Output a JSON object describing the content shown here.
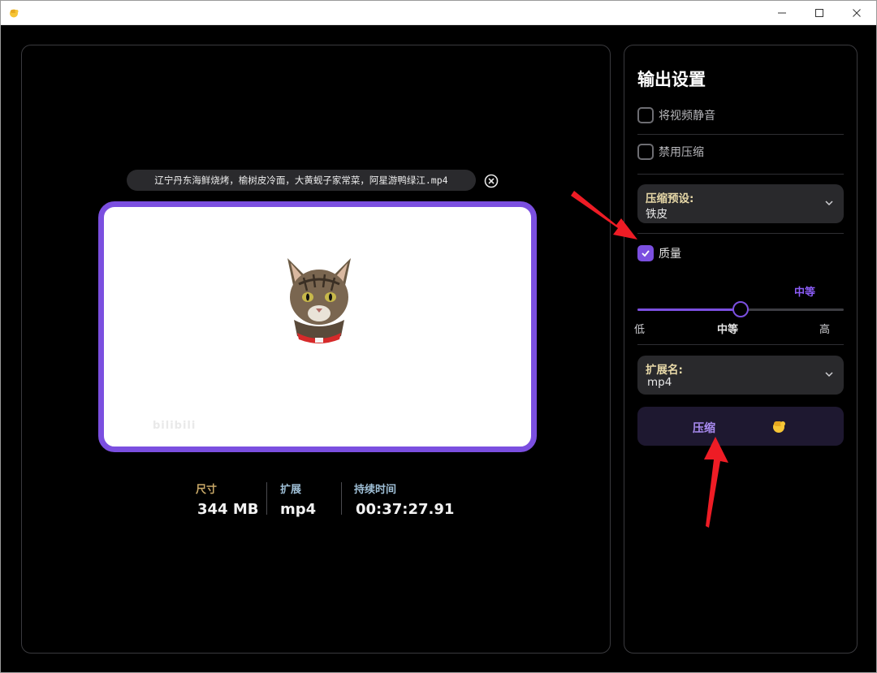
{
  "window": {
    "icon": "fist-emoji-icon",
    "controls": [
      "minimize-icon",
      "maximize-icon",
      "close-icon"
    ]
  },
  "preview": {
    "file_name": "辽宁丹东海鲜烧烤，榆树皮冷面，大黄蚬子家常菜，阿星游鸭绿江.mp4",
    "watermark": "bilibili"
  },
  "stats": [
    {
      "label": "尺寸",
      "value": "344 MB"
    },
    {
      "label": "扩展",
      "value": "mp4"
    },
    {
      "label": "持续时间",
      "value": "00:37:27.91"
    }
  ],
  "settings": {
    "title": "输出设置",
    "mute_label": "将视频静音",
    "mute_checked": false,
    "disable_label": "禁用压缩",
    "disable_checked": false,
    "preset_label": "压缩预设:",
    "preset_value": "铁皮",
    "quality_label": "质量",
    "quality_checked": true,
    "quality_current": "中等",
    "quality_level": 0.5,
    "quality_ticks": [
      "低",
      "中等",
      "高"
    ],
    "ext_label": "扩展名:",
    "ext_value": "mp4",
    "compress_label": "压缩",
    "accent_color": "#7b4fe0"
  }
}
